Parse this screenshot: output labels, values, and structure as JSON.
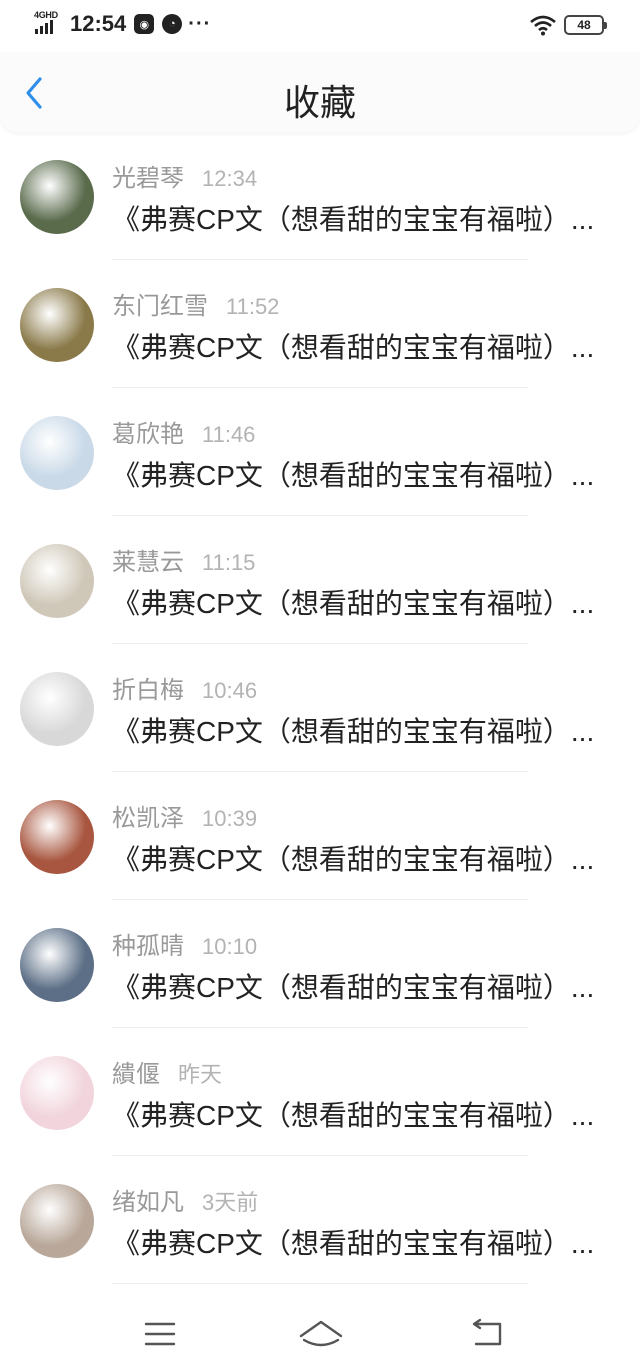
{
  "status_bar": {
    "network": "4GHD",
    "time": "12:54",
    "battery": "48",
    "icons": [
      "signal-icon",
      "qq-notification-icon",
      "app-notification-icon",
      "more-dots-icon",
      "wifi-icon",
      "battery-icon"
    ]
  },
  "header": {
    "title": "收藏",
    "back_icon": "chevron-left-icon"
  },
  "favorites": [
    {
      "name": "光碧琴",
      "time": "12:34",
      "message": "《弗赛CP文（想看甜的宝宝有福啦）...",
      "avatar_color": "#5a6b4c"
    },
    {
      "name": "东门红雪",
      "time": "11:52",
      "message": "《弗赛CP文（想看甜的宝宝有福啦）...",
      "avatar_color": "#8a7a4a"
    },
    {
      "name": "葛欣艳",
      "time": "11:46",
      "message": "《弗赛CP文（想看甜的宝宝有福啦）...",
      "avatar_color": "#c9d9e8"
    },
    {
      "name": "莱慧云",
      "time": "11:15",
      "message": "《弗赛CP文（想看甜的宝宝有福啦）...",
      "avatar_color": "#cfc7b8"
    },
    {
      "name": "折白梅",
      "time": "10:46",
      "message": "《弗赛CP文（想看甜的宝宝有福啦）...",
      "avatar_color": "#d8d8d8"
    },
    {
      "name": "松凯泽",
      "time": "10:39",
      "message": "《弗赛CP文（想看甜的宝宝有福啦）...",
      "avatar_color": "#a8563f"
    },
    {
      "name": "种孤晴",
      "time": "10:10",
      "message": "《弗赛CP文（想看甜的宝宝有福啦）...",
      "avatar_color": "#5c6f86"
    },
    {
      "name": "繢偃",
      "time": "昨天",
      "message": "《弗赛CP文（想看甜的宝宝有福啦）...",
      "avatar_color": "#f1d4dc"
    },
    {
      "name": "绪如凡",
      "time": "3天前",
      "message": "《弗赛CP文（想看甜的宝宝有福啦）...",
      "avatar_color": "#b9a89a"
    }
  ],
  "nav_bar": {
    "icons": [
      "menu-icon",
      "home-icon",
      "back-icon"
    ]
  },
  "colors": {
    "accent": "#2f8fe8",
    "name_text": "#999999",
    "time_text": "#b3b3b3",
    "message_text": "#222222",
    "divider": "#eeeeee"
  }
}
